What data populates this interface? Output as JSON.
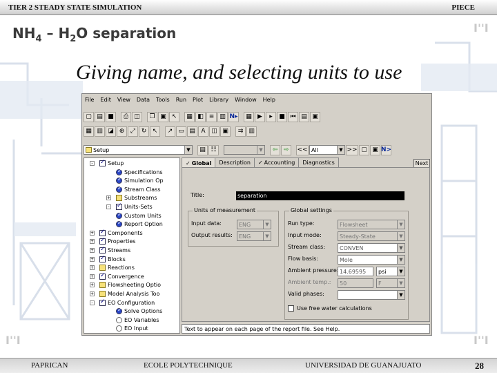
{
  "header": {
    "left": "TIER 2   STEADY STATE SIMULATION",
    "right": "PIECE"
  },
  "slide": {
    "title_main": "NH",
    "title_sub1": "4",
    "title_mid": " – H",
    "title_sub2": "2",
    "title_end": "O separation",
    "subtitle": "Giving name, and selecting units to use"
  },
  "app": {
    "menu": [
      "File",
      "Edit",
      "View",
      "Data",
      "Tools",
      "Run",
      "Plot",
      "Library",
      "Window",
      "Help"
    ],
    "nav": {
      "setup_combo": "Setup",
      "filter_combo": "All",
      "arrows_left": "<<",
      "arrows_right": ">>",
      "next_icon": "N>"
    },
    "tree": [
      {
        "label": "Setup",
        "icon": "chk",
        "indent": 0,
        "toggle": "-"
      },
      {
        "label": "Specifications",
        "icon": "blue",
        "indent": 2
      },
      {
        "label": "Simulation Op",
        "icon": "blue",
        "indent": 2
      },
      {
        "label": "Stream Class",
        "icon": "blue",
        "indent": 2
      },
      {
        "label": "Substreams",
        "icon": "fold",
        "indent": 2,
        "toggle": "+"
      },
      {
        "label": "Units-Sets",
        "icon": "chk",
        "indent": 2,
        "toggle": "-"
      },
      {
        "label": "Custom Units",
        "icon": "blue",
        "indent": 2
      },
      {
        "label": "Report Option",
        "icon": "blue",
        "indent": 2
      },
      {
        "label": "Components",
        "icon": "chk",
        "indent": 0,
        "toggle": "+"
      },
      {
        "label": "Properties",
        "icon": "chk",
        "indent": 0,
        "toggle": "+"
      },
      {
        "label": "Streams",
        "icon": "chk",
        "indent": 0,
        "toggle": "+"
      },
      {
        "label": "Blocks",
        "icon": "chk",
        "indent": 0,
        "toggle": "+"
      },
      {
        "label": "Reactions",
        "icon": "fold",
        "indent": 0,
        "toggle": "+"
      },
      {
        "label": "Convergence",
        "icon": "chk",
        "indent": 0,
        "toggle": "+"
      },
      {
        "label": "Flowsheeting Optio",
        "icon": "fold",
        "indent": 0,
        "toggle": "+"
      },
      {
        "label": "Model Analysis Too",
        "icon": "fold",
        "indent": 0,
        "toggle": "+"
      },
      {
        "label": "EO Configuration",
        "icon": "chk",
        "indent": 0,
        "toggle": "-"
      },
      {
        "label": "Solve Options",
        "icon": "blue",
        "indent": 2
      },
      {
        "label": "EO Variables",
        "icon": "circ",
        "indent": 2
      },
      {
        "label": "EO Input",
        "icon": "circ",
        "indent": 2
      }
    ],
    "tabs": [
      "Global",
      "Description",
      "Accounting",
      "Diagnostics"
    ],
    "next_button": "Next",
    "form": {
      "title_label": "Title:",
      "title_value": "separation",
      "units_group": "Units of measurement",
      "input_data_label": "Input data:",
      "input_data_value": "ENG",
      "output_results_label": "Output results:",
      "output_results_value": "ENG",
      "global_group": "Global settings",
      "run_type_label": "Run type:",
      "run_type_value": "Flowsheet",
      "input_mode_label": "Input mode:",
      "input_mode_value": "Steady-State",
      "stream_class_label": "Stream class:",
      "stream_class_value": "CONVEN",
      "flow_basis_label": "Flow basis:",
      "flow_basis_value": "Mole",
      "ambient_pressure_label": "Ambient pressure:",
      "ambient_pressure_value": "14.69595",
      "ambient_pressure_unit": "psi",
      "ambient_temp_label": "Ambient temp.:",
      "ambient_temp_value": "50",
      "ambient_temp_unit": "F",
      "valid_phases_label": "Valid phases:",
      "valid_phases_value": "",
      "free_water_label": "Use free water calculations"
    },
    "status_text": "Text to appear on each page of the report file. See Help."
  },
  "footer": {
    "left": "PAPRICAN",
    "center": "ECOLE POLYTECHNIQUE",
    "right": "UNIVERSIDAD DE GUANAJUATO",
    "page": "28"
  }
}
